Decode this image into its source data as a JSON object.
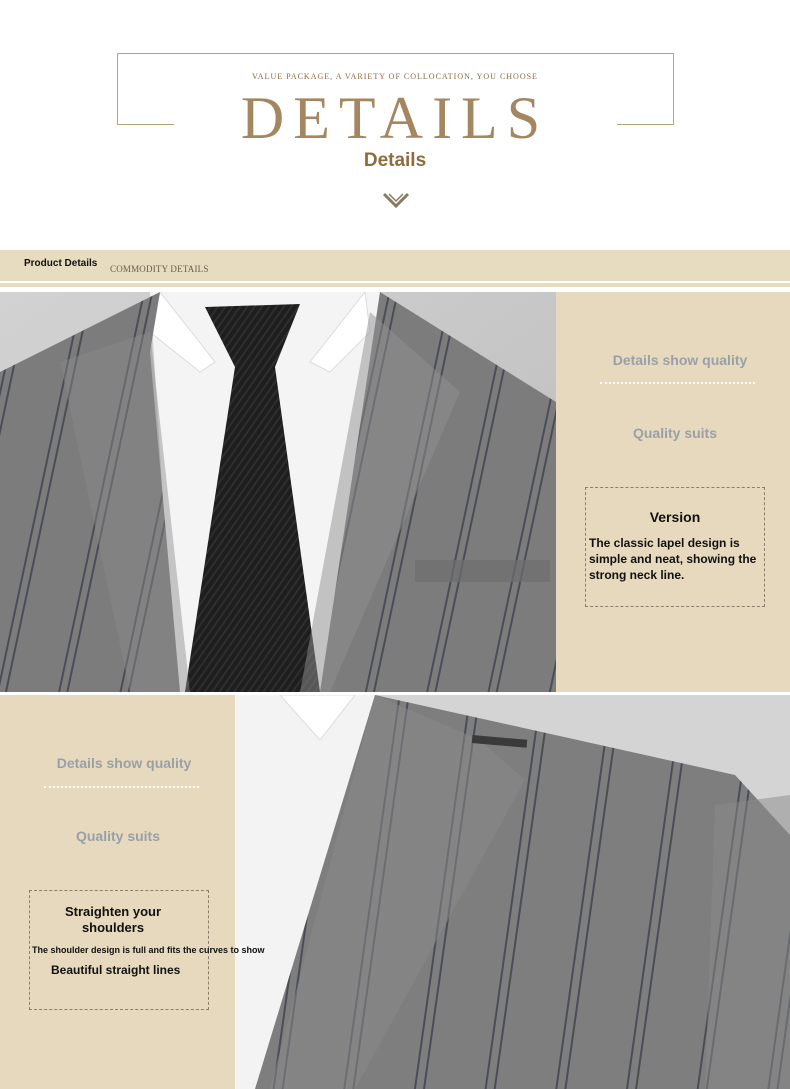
{
  "header": {
    "tagline": "VALUE PACKAGE, A VARIETY OF COLLOCATION, YOU CHOOSE",
    "title": "DETAILS",
    "subtitle": "Details",
    "chevron_icon": "chevron-down-icon"
  },
  "product_bar": {
    "label": "Product Details",
    "sub_label": "COMMODITY DETAILS"
  },
  "section1": {
    "quality_heading": "Details show quality",
    "quality_sub": "Quality suits",
    "box_title": "Version",
    "box_text": "The classic lapel design is simple and neat, showing the strong neck line."
  },
  "section2": {
    "quality_heading": "Details show quality",
    "quality_sub": "Quality suits",
    "box_title": "Straighten your shoulders",
    "box_text": "The shoulder design is full and fits the curves to show",
    "box_text2": "Beautiful straight lines"
  },
  "colors": {
    "accent": "#a48660",
    "panel": "#e6d9bd",
    "suit_gray": "#7a7a7a"
  }
}
